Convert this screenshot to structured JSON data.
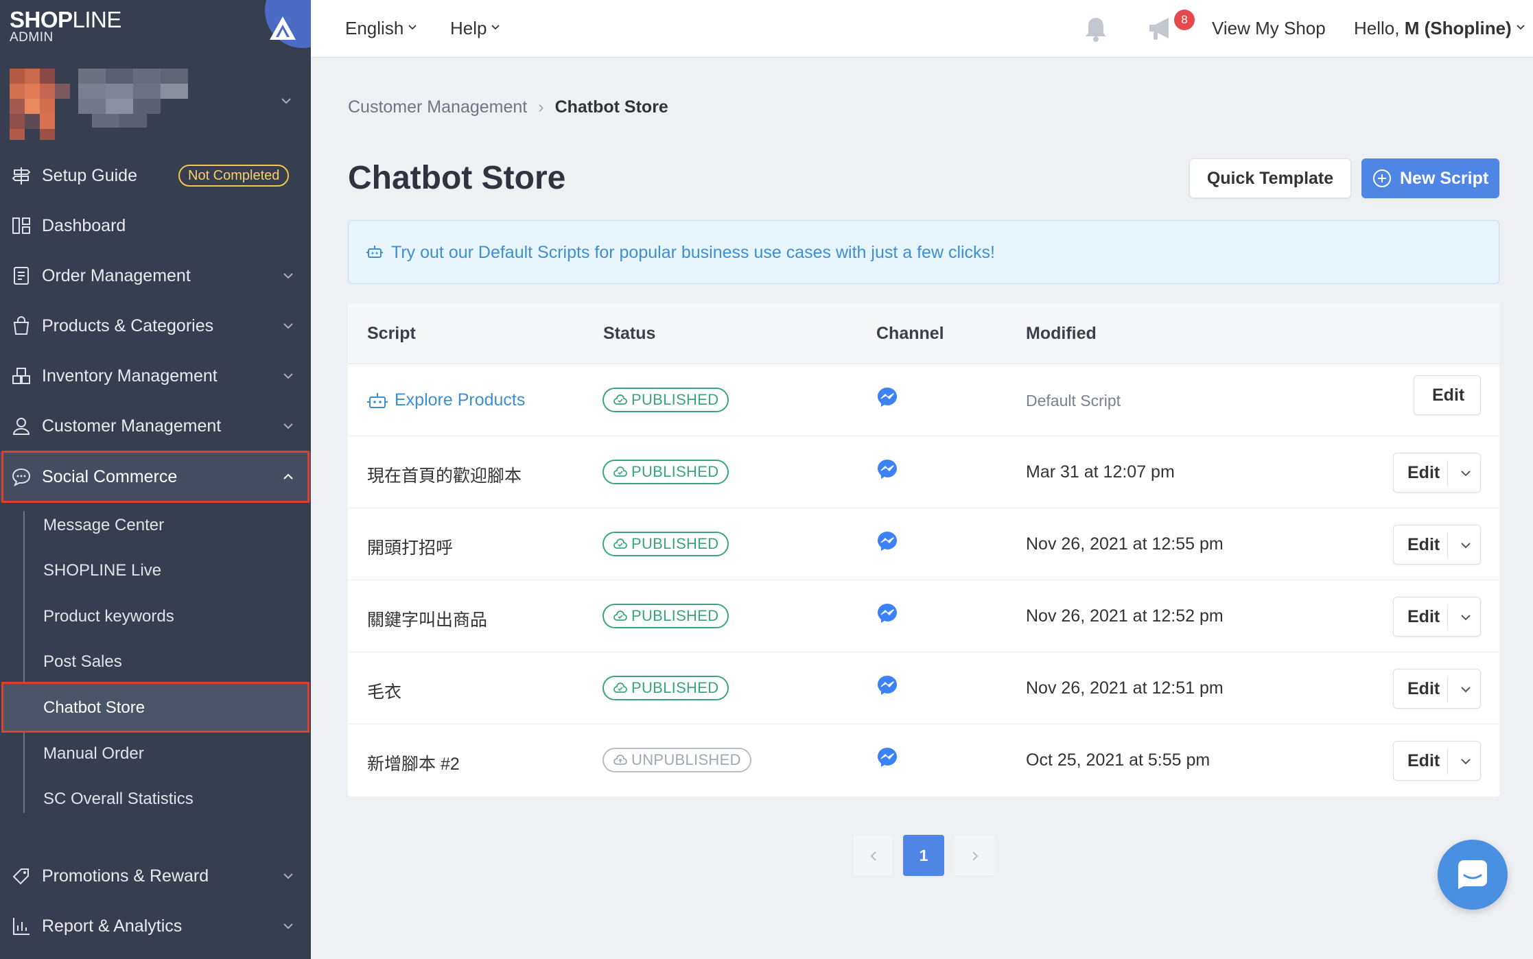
{
  "brand": {
    "logo_bold": "SHOP",
    "logo_light": "LINE",
    "logo_sub": "ADMIN"
  },
  "sidebar": {
    "setup_guide": {
      "label": "Setup Guide",
      "badge": "Not Completed",
      "icon": "signpost-icon"
    },
    "items": [
      {
        "label": "Dashboard",
        "icon": "dashboard-icon"
      },
      {
        "label": "Order Management",
        "icon": "order-icon"
      },
      {
        "label": "Products & Categories",
        "icon": "bag-icon"
      },
      {
        "label": "Inventory Management",
        "icon": "inventory-icon"
      },
      {
        "label": "Customer Management",
        "icon": "user-icon"
      },
      {
        "label": "Social Commerce",
        "icon": "chat-icon",
        "expanded": true
      },
      {
        "label": "Promotions & Reward",
        "icon": "tag-icon"
      },
      {
        "label": "Report & Analytics",
        "icon": "chart-icon"
      }
    ],
    "sub_items": [
      {
        "label": "Message Center"
      },
      {
        "label": "SHOPLINE Live"
      },
      {
        "label": "Product keywords"
      },
      {
        "label": "Post Sales"
      },
      {
        "label": "Chatbot Store",
        "active": true
      },
      {
        "label": "Manual Order"
      },
      {
        "label": "SC Overall Statistics"
      }
    ]
  },
  "topbar": {
    "language": "English",
    "help": "Help",
    "notification_count": "8",
    "view_shop": "View My Shop",
    "greeting_prefix": "Hello,",
    "greeting_name": "M (Shopline)"
  },
  "breadcrumb": {
    "parent": "Customer Management",
    "current": "Chatbot Store"
  },
  "page": {
    "title": "Chatbot Store",
    "quick_template": "Quick Template",
    "new_script": "New Script",
    "banner": "Try out our Default Scripts for popular business use cases with just a few clicks!"
  },
  "table": {
    "headers": {
      "script": "Script",
      "status": "Status",
      "channel": "Channel",
      "modified": "Modified"
    },
    "rows": [
      {
        "script": "Explore Products",
        "status": "PUBLISHED",
        "channel": "messenger",
        "modified": "Default Script",
        "action": "Edit"
      },
      {
        "script": "現在首頁的歡迎腳本",
        "status": "PUBLISHED",
        "channel": "messenger",
        "modified": "Mar 31 at 12:07 pm",
        "action": "Edit"
      },
      {
        "script": "開頭打招呼",
        "status": "PUBLISHED",
        "channel": "messenger",
        "modified": "Nov 26, 2021 at 12:55 pm",
        "action": "Edit"
      },
      {
        "script": "關鍵字叫出商品",
        "status": "PUBLISHED",
        "channel": "messenger",
        "modified": "Nov 26, 2021 at 12:52 pm",
        "action": "Edit"
      },
      {
        "script": "毛衣",
        "status": "PUBLISHED",
        "channel": "messenger",
        "modified": "Nov 26, 2021 at 12:51 pm",
        "action": "Edit"
      },
      {
        "script": "新增腳本 #2",
        "status": "UNPUBLISHED",
        "channel": "messenger",
        "modified": "Oct 25, 2021 at 5:55 pm",
        "action": "Edit"
      }
    ]
  },
  "pagination": {
    "current": "1"
  },
  "colors": {
    "sidebar": "#373e4f",
    "primary": "#4f86e6",
    "published": "#3aa57a",
    "highlight_border": "#e0412f",
    "badge": "#f2c94c"
  }
}
